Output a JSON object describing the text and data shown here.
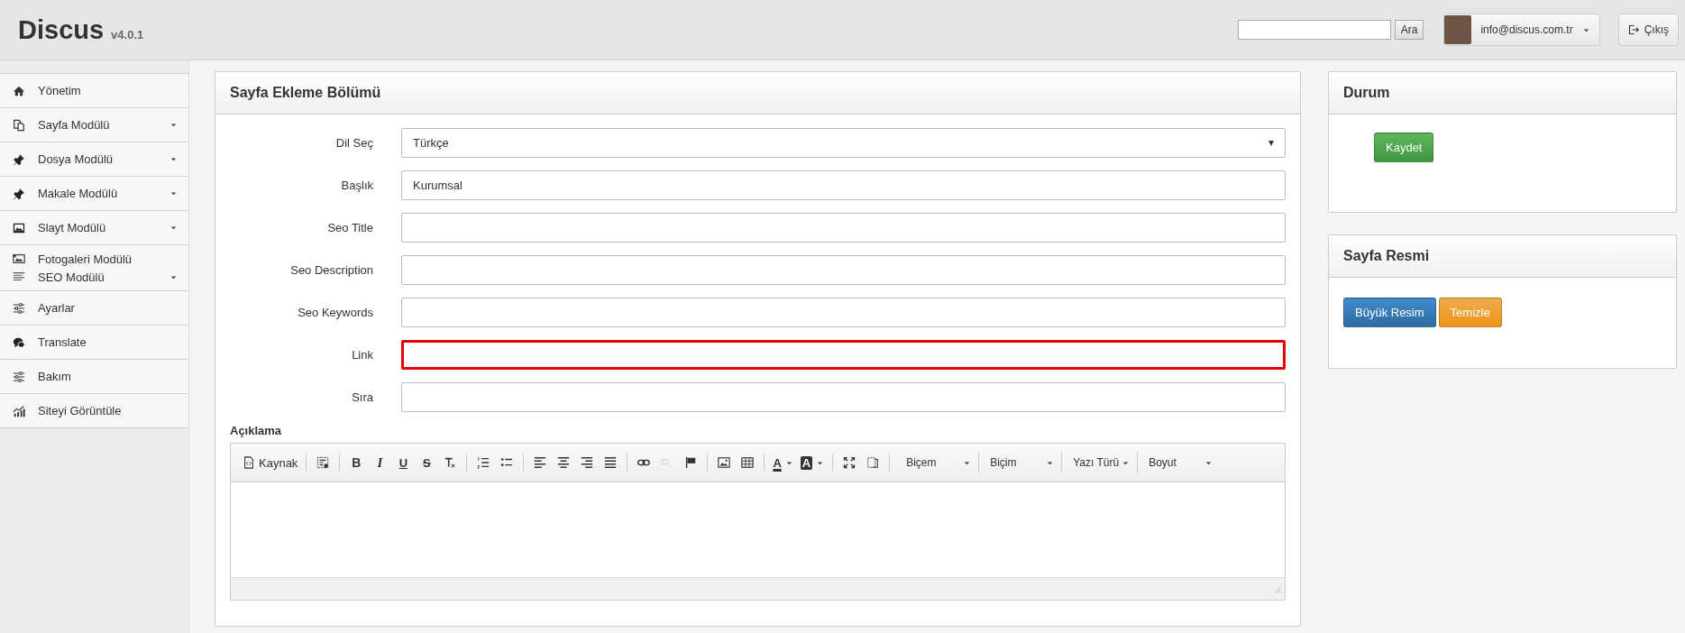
{
  "header": {
    "logo": "Discus",
    "version": "v4.0.1",
    "search": {
      "button": "Ara"
    },
    "user": {
      "email": "info@discus.com.tr"
    },
    "logout": "Çıkış"
  },
  "sidebar": {
    "items": [
      {
        "entries": [
          {
            "label": "Yönetim",
            "has_submenu": false
          }
        ]
      },
      {
        "entries": [
          {
            "label": "Sayfa Modülü",
            "has_submenu": true
          }
        ]
      },
      {
        "entries": [
          {
            "label": "Dosya Modülü",
            "has_submenu": true
          }
        ]
      },
      {
        "entries": [
          {
            "label": "Makale Modülü",
            "has_submenu": true
          }
        ]
      },
      {
        "entries": [
          {
            "label": "Slayt Modülü",
            "has_submenu": true
          }
        ]
      },
      {
        "entries": [
          {
            "label": "Fotogaleri Modülü",
            "has_submenu": false
          },
          {
            "label": "SEO Modülü",
            "has_submenu": true
          }
        ]
      },
      {
        "entries": [
          {
            "label": "Ayarlar",
            "has_submenu": false
          }
        ]
      },
      {
        "entries": [
          {
            "label": "Translate",
            "has_submenu": false
          }
        ]
      },
      {
        "entries": [
          {
            "label": "Bakım",
            "has_submenu": false
          }
        ]
      },
      {
        "entries": [
          {
            "label": "Siteyi Görüntüle",
            "has_submenu": false
          }
        ]
      }
    ]
  },
  "form_panel": {
    "title": "Sayfa Ekleme Bölümü",
    "fields": [
      {
        "kind": "select",
        "label": "Dil Seç",
        "value": "Türkçe",
        "error": false
      },
      {
        "kind": "text",
        "label": "Başlık",
        "value": "Kurumsal",
        "error": false
      },
      {
        "kind": "text",
        "label": "Seo Title",
        "error": false
      },
      {
        "kind": "text",
        "label": "Seo Description",
        "error": false
      },
      {
        "kind": "text",
        "label": "Seo Keywords",
        "error": false
      },
      {
        "kind": "text",
        "label": "Link",
        "error": true
      },
      {
        "kind": "text",
        "label": "Sıra",
        "error": false
      }
    ],
    "editor": {
      "label": "Açıklama",
      "toolbar": [
        {
          "kind": "icon",
          "label": "Kaynak",
          "disabled": false
        },
        {
          "kind": "separator"
        },
        {
          "kind": "icon",
          "disabled": false
        },
        {
          "kind": "separator"
        },
        {
          "kind": "bold",
          "label": "B",
          "disabled": false
        },
        {
          "kind": "italic",
          "label": "I",
          "disabled": false
        },
        {
          "kind": "underline",
          "label": "U",
          "disabled": false
        },
        {
          "kind": "strike",
          "label": "S",
          "disabled": false
        },
        {
          "kind": "icon",
          "disabled": false
        },
        {
          "kind": "separator"
        },
        {
          "kind": "icon",
          "disabled": false
        },
        {
          "kind": "icon",
          "disabled": false
        },
        {
          "kind": "separator"
        },
        {
          "kind": "icon",
          "disabled": false
        },
        {
          "kind": "icon",
          "disabled": false
        },
        {
          "kind": "icon",
          "disabled": false
        },
        {
          "kind": "icon",
          "disabled": false
        },
        {
          "kind": "separator"
        },
        {
          "kind": "icon",
          "disabled": false
        },
        {
          "kind": "icon",
          "disabled": true
        },
        {
          "kind": "icon",
          "disabled": false
        },
        {
          "kind": "separator"
        },
        {
          "kind": "icon",
          "disabled": false
        },
        {
          "kind": "icon",
          "disabled": false
        },
        {
          "kind": "separator"
        },
        {
          "kind": "text-color",
          "label": "A",
          "disabled": false
        },
        {
          "kind": "bg-color",
          "label": "A",
          "disabled": false
        },
        {
          "kind": "separator"
        },
        {
          "kind": "icon",
          "disabled": false
        },
        {
          "kind": "icon",
          "disabled": false
        },
        {
          "kind": "separator"
        },
        {
          "kind": "combo",
          "label": "Biçem"
        },
        {
          "kind": "combo",
          "label": "Biçim"
        },
        {
          "kind": "combo",
          "label": "Yazı Türü"
        },
        {
          "kind": "combo",
          "label": "Boyut"
        }
      ]
    }
  },
  "status_panel": {
    "title": "Durum",
    "save_button": "Kaydet"
  },
  "image_panel": {
    "title": "Sayfa Resmi",
    "buttons": [
      {
        "kind": "primary",
        "label": "Büyük Resim"
      },
      {
        "kind": "warning",
        "label": "Temizle"
      }
    ]
  }
}
